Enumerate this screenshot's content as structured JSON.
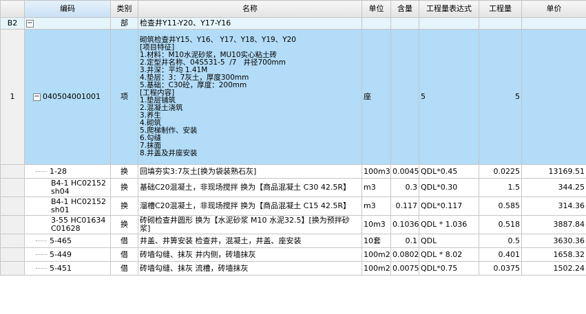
{
  "columns": [
    "",
    "编码",
    "类别",
    "名称",
    "单位",
    "含量",
    "工程量表达式",
    "工程量",
    "单价"
  ],
  "group": {
    "row": "B2",
    "category": "部",
    "name": "检查井Y11-Y20、Y17-Y16"
  },
  "item": {
    "row": "1",
    "code": "040504001001",
    "category": "项",
    "description": "砌筑检查井Y15、Y16、 Y17、Y18、Y19、Y20\n[项目特征]\n1.材料：M10水泥砂浆，MU10实心粘土砖\n2.定型井名称、04S531-5  /7   井径700mm\n3.井深：平均 1.41M\n4.垫层：3：7灰土，厚度300mm\n5.基础：C30砼，厚度：200mm\n[工程内容]\n1.垫层铺筑\n2.混凝土浇筑\n3.养生\n4.砌筑\n5.爬梯制作、安装\n6.勾缝\n7.抹面\n8.井盖及井座安装",
    "unit": "座",
    "expression": "5",
    "quantity": "5"
  },
  "subitems": [
    {
      "code": "1-28",
      "category": "换",
      "name": "回填夯实3:7灰土[换为袋装熟石灰]",
      "unit": "100m3",
      "content": "0.0045",
      "expression": "QDL*0.45",
      "quantity": "0.0225",
      "price": "13169.51"
    },
    {
      "code": "B4-1 HC02152 sh04",
      "category": "换",
      "name": "基础C20混凝土，非现场搅拌 换为【商品混凝土 C30   42.5R】",
      "unit": "m3",
      "content": "0.3",
      "expression": "QDL*0.30",
      "quantity": "1.5",
      "price": "344.25"
    },
    {
      "code": "B4-1 HC02152 sh01",
      "category": "换",
      "name": "溜槽C20混凝土，非现场搅拌  换为【商品混凝土 C15   42.5R】",
      "unit": "m3",
      "content": "0.117",
      "expression": "QDL*0.117",
      "quantity": "0.585",
      "price": "314.36"
    },
    {
      "code": "3-55 HC01634 C01628",
      "category": "换",
      "name": "砖砌检查井圆形 换为【水泥砂浆 M10 水泥32.5】[换为预拌砂浆]",
      "unit": "10m3",
      "content": "0.1036",
      "expression": "QDL * 1.036",
      "quantity": "0.518",
      "price": "3887.84"
    },
    {
      "code": "5-465",
      "category": "借",
      "name": "井盖、井箅安装 检查井，混凝土，井盖、座安装",
      "unit": "10套",
      "content": "0.1",
      "expression": "QDL",
      "quantity": "0.5",
      "price": "3630.36"
    },
    {
      "code": "5-449",
      "category": "借",
      "name": "砖墙勾缝、抹灰 井内侧，砖墙抹灰",
      "unit": "100m2",
      "content": "0.0802",
      "expression": "QDL * 8.02",
      "quantity": "0.401",
      "price": "1658.32"
    },
    {
      "code": "5-451",
      "category": "借",
      "name": "砖墙勾缝、抹灰 流槽，砖墙抹灰",
      "unit": "100m2",
      "content": "0.0075",
      "expression": "QDL*0.75",
      "quantity": "0.0375",
      "price": "1502.24"
    }
  ]
}
